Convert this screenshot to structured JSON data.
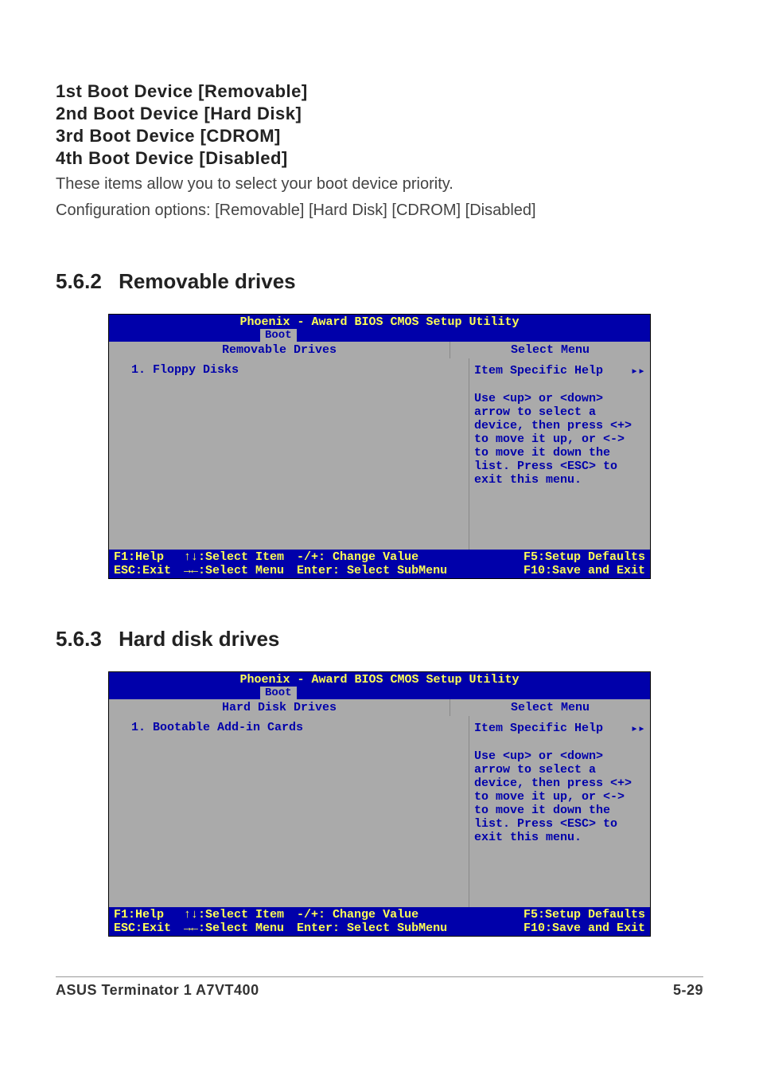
{
  "options": {
    "boot1": "1st Boot Device [Removable]",
    "boot2": "2nd Boot Device [Hard Disk]",
    "boot3": "3rd Boot Device [CDROM]",
    "boot4": "4th Boot Device [Disabled]",
    "desc1": "These items allow you to select your boot device priority.",
    "desc2": "Configuration options: [Removable] [Hard Disk] [CDROM] [Disabled]"
  },
  "sections": {
    "s562_num": "5.6.2",
    "s562_title": "Removable drives",
    "s563_num": "5.6.3",
    "s563_title": "Hard disk drives"
  },
  "bios_common": {
    "utility_title": "Phoenix - Award BIOS CMOS Setup Utility",
    "tab": "Boot",
    "select_menu": "Select Menu",
    "help_title": "Item Specific Help",
    "help_arrow": "▸▸",
    "help_body": "Use <up> or <down> arrow to select a device, then press <+> to move it up, or <-> to move it down the list. Press <ESC> to exit this menu.",
    "footer": {
      "f1": "F1:Help",
      "esc": "ESC:Exit",
      "sel_item": "↑↓:Select Item",
      "sel_menu": "→←:Select Menu",
      "change": "-/+: Change Value",
      "enter": "Enter: Select SubMenu",
      "f5": "F5:Setup Defaults",
      "f10": "F10:Save and Exit"
    }
  },
  "bios1": {
    "panel_title": "Removable Drives",
    "item1": "1. Floppy Disks"
  },
  "bios2": {
    "panel_title": "Hard Disk Drives",
    "item1": "1. Bootable Add-in Cards"
  },
  "footer": {
    "left": "ASUS Terminator 1 A7VT400",
    "right": "5-29"
  }
}
